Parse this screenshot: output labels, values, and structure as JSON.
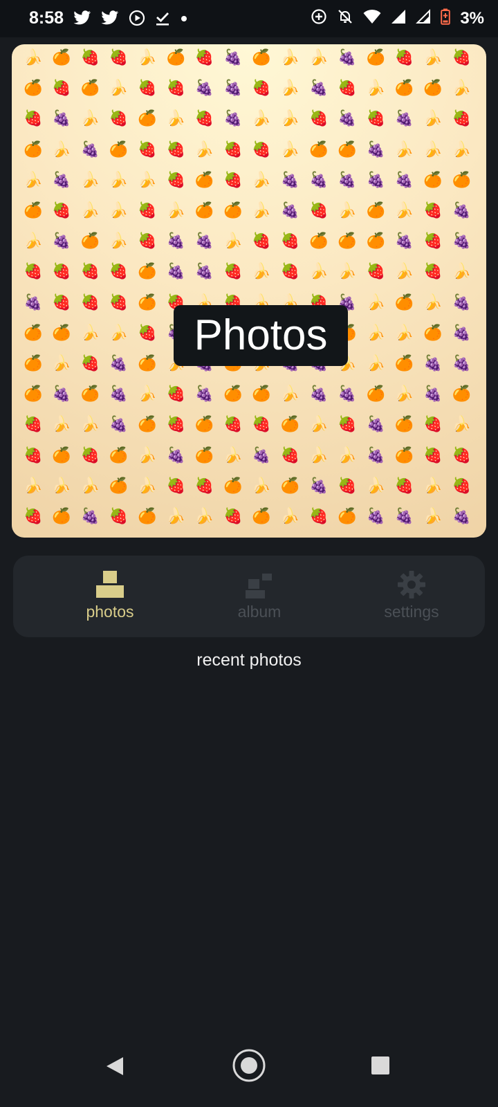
{
  "status_bar": {
    "time": "8:58",
    "battery_text": "3%",
    "left_icons": [
      "twitter-icon",
      "twitter-icon",
      "media-play-icon",
      "download-done-icon",
      "dot-icon"
    ],
    "right_icons": [
      "data-saver-icon",
      "alarm-off-icon",
      "wifi-icon",
      "signal-icon",
      "signal-outline-icon",
      "battery-low-icon"
    ]
  },
  "hero": {
    "title": "Photos",
    "fruits": [
      "🍓",
      "🍌",
      "🍊",
      "🍇"
    ]
  },
  "bottom_nav": {
    "items": [
      {
        "label": "photos",
        "icon": "photos-stack-icon",
        "active": true
      },
      {
        "label": "album",
        "icon": "album-icon",
        "active": false
      },
      {
        "label": "settings",
        "icon": "gear-icon",
        "active": false
      }
    ]
  },
  "section": {
    "heading": "recent photos"
  },
  "system_nav": {
    "buttons": [
      "back-icon",
      "home-icon",
      "recents-icon"
    ]
  },
  "colors": {
    "background": "#181b1f",
    "status_bar": "#0f1216",
    "nav_card": "#23272c",
    "active_accent": "#d9cd8a",
    "inactive_text": "#4b5056",
    "hero_title_bg": "#121619"
  }
}
